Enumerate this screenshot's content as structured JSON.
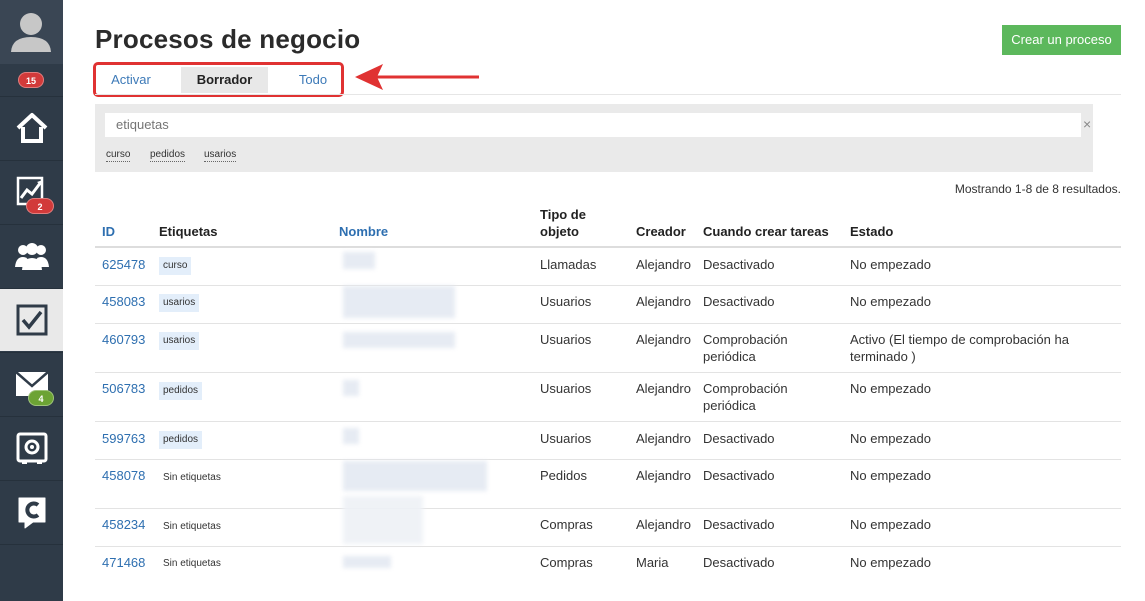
{
  "sidebar": {
    "avatar_badge": "15",
    "items": [
      {
        "name": "home",
        "icon": "home-icon",
        "badge": null
      },
      {
        "name": "analytics",
        "icon": "chart-icon",
        "badge": "2",
        "badge_color": "#d23a3a"
      },
      {
        "name": "contacts",
        "icon": "users-icon",
        "badge": null
      },
      {
        "name": "tasks",
        "icon": "checkbox-icon",
        "badge": null,
        "active": true
      },
      {
        "name": "mail",
        "icon": "envelope-icon",
        "badge": "4",
        "badge_color": "#6ca334"
      },
      {
        "name": "settings",
        "icon": "gear-box-icon",
        "badge": null
      },
      {
        "name": "chat",
        "icon": "chat-c-icon",
        "badge": null
      }
    ]
  },
  "header": {
    "title": "Procesos de negocio",
    "create_button": "Crear un proceso"
  },
  "tabs": [
    {
      "label": "Activar",
      "selected": false
    },
    {
      "label": "Borrador",
      "selected": true
    },
    {
      "label": "Todo",
      "selected": false
    }
  ],
  "filter": {
    "placeholder": "etiquetas",
    "clear": "×",
    "tags": [
      "curso",
      "pedidos",
      "usarios"
    ]
  },
  "results_text": "Mostrando 1-8 de 8 resultados.",
  "table": {
    "columns": [
      "ID",
      "Etiquetas",
      "Nombre",
      "Tipo de objeto",
      "Creador",
      "Cuando crear tareas",
      "Estado"
    ],
    "columns_split": {
      "tipo_line1": "Tipo de",
      "tipo_line2": "objeto"
    },
    "rows": [
      {
        "id": "625478",
        "label": "curso",
        "type": "Llamadas",
        "creator": "Alejandro",
        "when": "Desactivado",
        "when2": "",
        "status": "No empezado",
        "status2": ""
      },
      {
        "id": "458083",
        "label": "usarios",
        "type": "Usuarios",
        "creator": "Alejandro",
        "when": "Desactivado",
        "when2": "",
        "status": "No empezado",
        "status2": ""
      },
      {
        "id": "460793",
        "label": "usarios",
        "type": "Usuarios",
        "creator": "Alejandro",
        "when": "Comprobación",
        "when2": "periódica",
        "status": "Activo (El tiempo de comprobación ha",
        "status2": "terminado )"
      },
      {
        "id": "506783",
        "label": "pedidos",
        "type": "Usuarios",
        "creator": "Alejandro",
        "when": "Comprobación",
        "when2": "periódica",
        "status": "No empezado",
        "status2": ""
      },
      {
        "id": "599763",
        "label": "pedidos",
        "type": "Usuarios",
        "creator": "Alejandro",
        "when": "Desactivado",
        "when2": "",
        "status": "No empezado",
        "status2": ""
      },
      {
        "id": "458078",
        "label": "Sin etiquetas",
        "type": "Pedidos",
        "creator": "Alejandro",
        "when": "Desactivado",
        "when2": "",
        "status": "No empezado",
        "status2": ""
      },
      {
        "id": "458234",
        "label": "Sin etiquetas",
        "type": "Compras",
        "creator": "Alejandro",
        "when": "Desactivado",
        "when2": "",
        "status": "No empezado",
        "status2": ""
      },
      {
        "id": "471468",
        "label": "Sin etiquetas",
        "type": "Compras",
        "creator": "Maria",
        "when": "Desactivado",
        "when2": "",
        "status": "No empezado",
        "status2": ""
      }
    ]
  },
  "colors": {
    "sidebar_bg": "#2f3b48",
    "link": "#2e6fb0",
    "create_button": "#5cb85c",
    "highlight": "#e03232"
  }
}
